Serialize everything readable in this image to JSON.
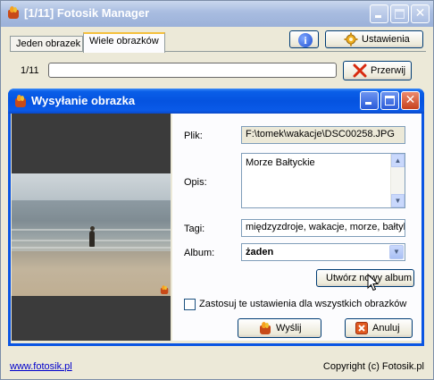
{
  "outer_window": {
    "title": "[1/11] Fotosik Manager"
  },
  "tabs": [
    {
      "label": "Jeden obrazek",
      "active": false
    },
    {
      "label": "Wiele obrazków",
      "active": true
    }
  ],
  "toolbar": {
    "info_icon": "i",
    "settings_label": "Ustawienia"
  },
  "progress": {
    "label": "1/11",
    "fraction": 0.0,
    "cancel_label": "Przerwij"
  },
  "dialog": {
    "title": "Wysyłanie obrazka",
    "form": {
      "file_label": "Plik:",
      "file_value": "F:\\tomek\\wakacje\\DSC00258.JPG",
      "description_label": "Opis:",
      "description_value": "Morze Bałtyckie",
      "tags_label": "Tagi:",
      "tags_value": "międzyzdroje, wakacje, morze, bałtyk",
      "album_label": "Album:",
      "album_value": "żaden",
      "create_album_label": "Utwórz nowy album",
      "apply_all_label": "Zastosuj te ustawienia dla wszystkich obrazków",
      "apply_all_checked": false,
      "send_label": "Wyślij",
      "cancel_label": "Anuluj"
    }
  },
  "footer": {
    "link": "www.fotosik.pl",
    "copyright": "Copyright (c) Fotosik.pl"
  },
  "colors": {
    "xp_blue": "#0a55e3",
    "inactive_title": "#a8bce0",
    "close_red": "#c6421e",
    "progress_green": "#3cb33c"
  }
}
